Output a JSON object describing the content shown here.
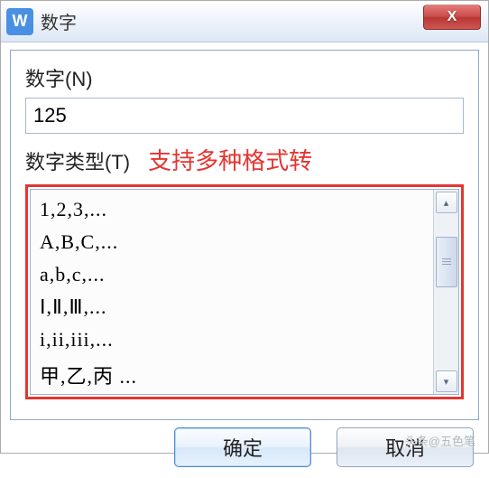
{
  "title_bar": {
    "app_icon_letter": "W",
    "title": "数字",
    "close_glyph": "X"
  },
  "fields": {
    "number_label": "数字(N)",
    "number_value": "125",
    "type_label": "数字类型(T)"
  },
  "annotation": "支持多种格式转",
  "format_list": [
    "1,2,3,...",
    "A,B,C,...",
    "a,b,c,...",
    "Ⅰ,Ⅱ,Ⅲ,...",
    "i,ii,iii,...",
    "甲,乙,丙 ..."
  ],
  "scroll": {
    "up_glyph": "▴",
    "down_glyph": "▾"
  },
  "buttons": {
    "ok": "确定",
    "cancel": "取消"
  },
  "watermark": "头条@五色笔"
}
